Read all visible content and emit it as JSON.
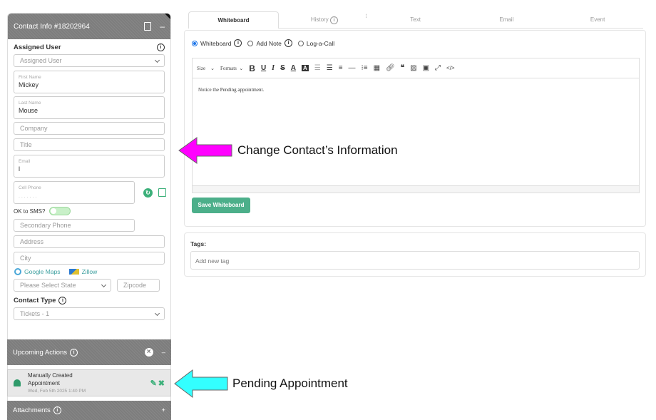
{
  "contact": {
    "header_title": "Contact Info #18202964",
    "assigned_label": "Assigned User",
    "assigned_value": "Assigned User",
    "first_name_label": "First Name",
    "first_name_value": "Mickey",
    "last_name_label": "Last Name",
    "last_name_value": "Mouse",
    "company_placeholder": "Company",
    "title_placeholder": "Title",
    "email_label": "Email",
    "email_value": "l",
    "cell_label": "Cell Phone",
    "sms_label": "OK to SMS?",
    "secondary_phone_placeholder": "Secondary Phone",
    "address_placeholder": "Address",
    "city_placeholder": "City",
    "google_maps": "Google Maps",
    "zillow": "Zillow",
    "state_value": "Please Select State",
    "zip_placeholder": "Zipcode",
    "contact_type_label": "Contact Type",
    "contact_type_value": "Tickets - 1"
  },
  "upcoming": {
    "title": "Upcoming Actions",
    "item_title_1": "Manually Created",
    "item_title_2": "Appointment",
    "item_date": "Wed, Feb 5th 2025 1:40 PM"
  },
  "attachments": {
    "title": "Attachments",
    "plus": "+"
  },
  "tabs": [
    "Whiteboard",
    "History",
    "Text",
    "Email",
    "Event"
  ],
  "editor": {
    "radio_whiteboard": "Whiteboard",
    "radio_add_note": "Add Note",
    "radio_log_call": "Log-a-Call",
    "size_label": "Size",
    "formats_label": "Formats",
    "body_text": "Notice the Pending appointment.",
    "save_button": "Save Whiteboard"
  },
  "tags": {
    "label": "Tags:",
    "placeholder": "Add new tag"
  },
  "annotations": {
    "change_contact": "Change Contact’s Information",
    "pending_appt": "Pending Appointment"
  },
  "colors": {
    "accent_green": "#4caf8a",
    "magenta_arrow": "#ff00ff",
    "cyan_arrow": "#33ffff"
  },
  "icons": {
    "info": "i",
    "minus": "–",
    "close": "×"
  }
}
